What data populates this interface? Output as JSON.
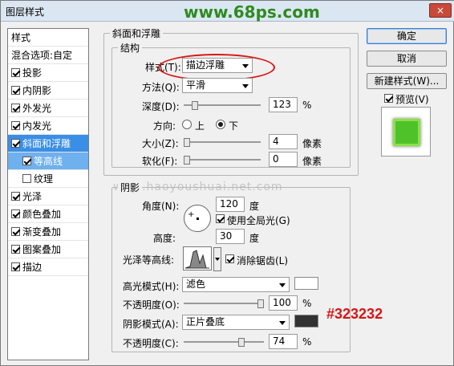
{
  "window": {
    "title": "图层样式",
    "close_label": "×",
    "site_watermark": "www.68ps.com"
  },
  "left_panel": {
    "header": "样式",
    "blend_options": "混合选项:自定",
    "items": [
      {
        "label": "投影",
        "checked": true
      },
      {
        "label": "内阴影",
        "checked": true
      },
      {
        "label": "外发光",
        "checked": true
      },
      {
        "label": "内发光",
        "checked": true
      },
      {
        "label": "斜面和浮雕",
        "checked": true
      },
      {
        "label": "等高线",
        "checked": true
      },
      {
        "label": "纹理",
        "checked": false
      },
      {
        "label": "光泽",
        "checked": true
      },
      {
        "label": "颜色叠加",
        "checked": true
      },
      {
        "label": "渐变叠加",
        "checked": true
      },
      {
        "label": "图案叠加",
        "checked": true
      },
      {
        "label": "描边",
        "checked": true
      }
    ]
  },
  "bevel": {
    "group_title": "斜面和浮雕",
    "structure_title": "结构",
    "style_label": "样式(T):",
    "style_value": "描边浮雕",
    "method_label": "方法(Q):",
    "method_value": "平滑",
    "depth_label": "深度(D):",
    "depth_value": "123",
    "depth_unit": "%",
    "direction_label": "方向:",
    "dir_up": "上",
    "dir_down": "下",
    "size_label": "大小(Z):",
    "size_value": "4",
    "size_unit": "像素",
    "soften_label": "软化(F):",
    "soften_value": "0",
    "soften_unit": "像素"
  },
  "shading": {
    "group_title": "阴影",
    "angle_label": "角度(N):",
    "angle_value": "120",
    "angle_unit": "度",
    "global_light_label": "使用全局光(G)",
    "altitude_label": "高度:",
    "altitude_value": "30",
    "altitude_unit": "度",
    "gloss_contour_label": "光泽等高线:",
    "antialias_label": "消除锯齿(L)",
    "highlight_mode_label": "高光模式(H):",
    "highlight_mode_value": "滤色",
    "highlight_opacity_label": "不透明度(O):",
    "highlight_opacity_value": "100",
    "highlight_opacity_unit": "%",
    "shadow_mode_label": "阴影模式(A):",
    "shadow_mode_value": "正片叠底",
    "shadow_opacity_label": "不透明度(C):",
    "shadow_opacity_value": "74",
    "shadow_opacity_unit": "%",
    "highlight_color": "#ffffff",
    "shadow_color": "#323232",
    "shadow_color_annotation": "#323232"
  },
  "buttons": {
    "ok": "确定",
    "cancel": "取消",
    "new_style": "新建样式(W)...",
    "preview": "预览(V)"
  },
  "watermark_text": "www.haoyoushuai.net.com"
}
